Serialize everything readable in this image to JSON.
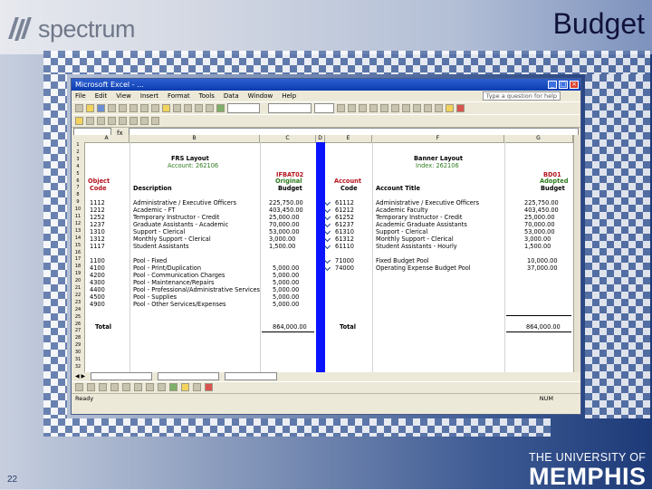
{
  "slide": {
    "title": "Budget",
    "logo_text": "spectrum",
    "page_number": "22",
    "university_line1": "THE UNIVERSITY OF",
    "university_line2": "MEMPHIS"
  },
  "window": {
    "title": "Microsoft Excel - ...",
    "help_box": "Type a question for help"
  },
  "menu": [
    "File",
    "Edit",
    "View",
    "Insert",
    "Format",
    "Tools",
    "Data",
    "Window",
    "Help"
  ],
  "sheet": {
    "frs_title": "FRS Layout",
    "frs_sub": "Account: 262106",
    "banner_title": "Banner Layout",
    "banner_sub": "Index: 262106",
    "ifbat": "IFBAT02",
    "bd01": "BD01",
    "headers": {
      "object": "Object",
      "code": "Code",
      "description": "Description",
      "original": "Original",
      "budget": "Budget",
      "account": "Account",
      "account_code": "Code",
      "account_title": "Account Title",
      "adopted": "Adopted",
      "adopted_budget": "Budget"
    },
    "rows": [
      {
        "code": "1112",
        "desc": "Administrative / Executive Officers",
        "orig": "225,750.00",
        "acct": "61112",
        "title": "Administrative / Executive Officers",
        "adopt": "225,750.00"
      },
      {
        "code": "1212",
        "desc": "Academic - FT",
        "orig": "403,450.00",
        "acct": "61212",
        "title": "Academic Faculty",
        "adopt": "403,450.00"
      },
      {
        "code": "1252",
        "desc": "Temporary Instructor - Credit",
        "orig": "25,000.00",
        "acct": "61252",
        "title": "Temporary Instructor - Credit",
        "adopt": "25,000.00"
      },
      {
        "code": "1237",
        "desc": "Graduate Assistants - Academic",
        "orig": "70,000.00",
        "acct": "61237",
        "title": "Academic Graduate Assistants",
        "adopt": "70,000.00"
      },
      {
        "code": "1310",
        "desc": "Support - Clerical",
        "orig": "53,000.00",
        "acct": "61310",
        "title": "Support - Clerical",
        "adopt": "53,000.00"
      },
      {
        "code": "1312",
        "desc": "Monthly Support - Clerical",
        "orig": "3,000.00",
        "acct": "61312",
        "title": "Monthly Support - Clerical",
        "adopt": "3,000.00"
      },
      {
        "code": "1117",
        "desc": "Student Assistants",
        "orig": "1,500.00",
        "acct": "61110",
        "title": "Student Assistants - Hourly",
        "adopt": "1,500.00"
      }
    ],
    "rows2": [
      {
        "code": "1100",
        "desc": "Pool - Fixed",
        "orig": "",
        "acct": "71000",
        "title": "Fixed Budget Pool",
        "adopt": "10,000.00"
      },
      {
        "code": "4100",
        "desc": "Pool - Print/Duplication",
        "orig": "5,000.00",
        "acct": "74000",
        "title": "Operating Expense Budget Pool",
        "adopt": "37,000.00"
      },
      {
        "code": "4200",
        "desc": "Pool - Communication Charges",
        "orig": "5,000.00",
        "acct": "",
        "title": "",
        "adopt": ""
      },
      {
        "code": "4300",
        "desc": "Pool - Maintenance/Repairs",
        "orig": "5,000.00",
        "acct": "",
        "title": "",
        "adopt": ""
      },
      {
        "code": "4400",
        "desc": "Pool - Professional/Administrative Services",
        "orig": "5,000.00",
        "acct": "",
        "title": "",
        "adopt": ""
      },
      {
        "code": "4500",
        "desc": "Pool - Supplies",
        "orig": "5,000.00",
        "acct": "",
        "title": "",
        "adopt": ""
      },
      {
        "code": "4900",
        "desc": "Pool - Other Services/Expenses",
        "orig": "5,000.00",
        "acct": "",
        "title": "",
        "adopt": ""
      }
    ],
    "total_label": "Total",
    "total_value": "864,000.00",
    "adopted_total": "864,000.00"
  },
  "status": {
    "ready": "Ready",
    "num": "NUM"
  },
  "colors": {
    "accent_bar": "#0a14ff"
  }
}
